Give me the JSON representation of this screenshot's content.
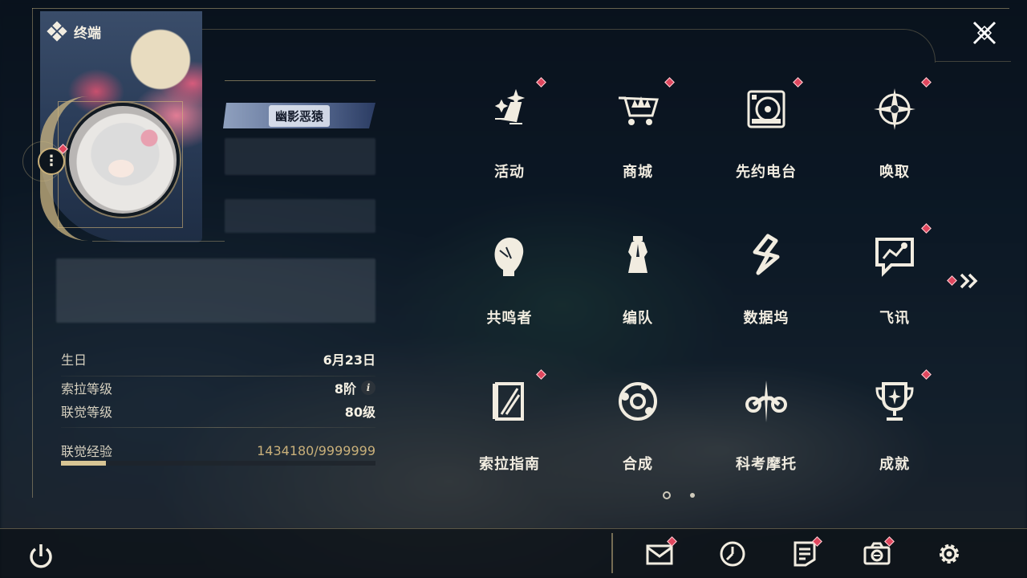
{
  "header": {
    "title": "终端",
    "icon": "four-diamond-icon"
  },
  "close": {
    "icon": "close-icon"
  },
  "profile": {
    "nickname_badge": "幽影恶猿",
    "menu_icon": "more-vertical-icon"
  },
  "stats": {
    "birthday_label": "生日",
    "birthday_value": "6月23日",
    "sola_level_label": "索拉等级",
    "sola_level_value": "8阶",
    "union_level_label": "联觉等级",
    "union_level_value": "80级",
    "union_exp_label": "联觉经验",
    "union_exp_value": "1434180/9999999",
    "union_exp_fraction": 0.1434
  },
  "menu": {
    "items": [
      {
        "label": "活动",
        "icon": "sparkle-flag-icon",
        "badge": true
      },
      {
        "label": "商城",
        "icon": "crown-cart-icon",
        "badge": true
      },
      {
        "label": "先约电台",
        "icon": "radio-disc-icon",
        "badge": true
      },
      {
        "label": "唤取",
        "icon": "compass-star-icon",
        "badge": true
      },
      {
        "label": "共鸣者",
        "icon": "character-head-icon",
        "badge": false
      },
      {
        "label": "编队",
        "icon": "chess-pieces-icon",
        "badge": false
      },
      {
        "label": "数据坞",
        "icon": "data-dock-icon",
        "badge": false
      },
      {
        "label": "飞讯",
        "icon": "chat-bubble-icon",
        "badge": true
      },
      {
        "label": "索拉指南",
        "icon": "guide-book-icon",
        "badge": true
      },
      {
        "label": "合成",
        "icon": "synthesis-orbit-icon",
        "badge": false
      },
      {
        "label": "科考摩托",
        "icon": "motorcycle-icon",
        "badge": false
      },
      {
        "label": "成就",
        "icon": "trophy-icon",
        "badge": true
      }
    ]
  },
  "pager": {
    "pages": 2,
    "current": 1
  },
  "bottom_bar": {
    "power": "power-icon",
    "tools": [
      {
        "icon": "mail-icon",
        "badge": true
      },
      {
        "icon": "clock-icon",
        "badge": false
      },
      {
        "icon": "notice-icon",
        "badge": true
      },
      {
        "icon": "camera-icon",
        "badge": true
      },
      {
        "icon": "settings-gear-icon",
        "badge": false
      }
    ]
  },
  "colors": {
    "accent": "#c9b07a",
    "badge": "#e0475e",
    "text": "#f1ece0"
  }
}
